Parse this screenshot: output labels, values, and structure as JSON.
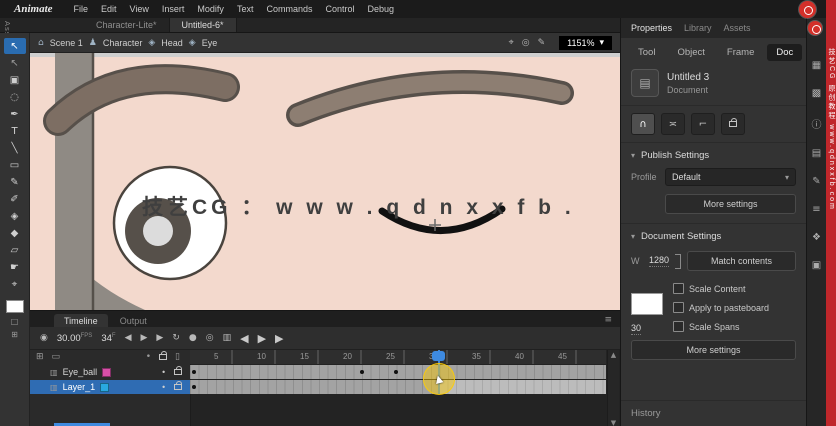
{
  "menu": {
    "logo": "Animate",
    "items": [
      "File",
      "Edit",
      "View",
      "Insert",
      "Modify",
      "Text",
      "Commands",
      "Control",
      "Debug"
    ]
  },
  "doc_tabs": [
    {
      "label": "Character-Lite*"
    },
    {
      "label": "Untitled-6*"
    }
  ],
  "left_rail": {
    "vertical_tab": "Assets"
  },
  "toolbar": {
    "tools": [
      {
        "name": "selection-tool",
        "glyph": "↖"
      },
      {
        "name": "subselection-tool",
        "glyph": "↖"
      },
      {
        "name": "free-transform-tool",
        "glyph": "▣"
      },
      {
        "name": "lasso-tool",
        "glyph": "◌"
      },
      {
        "name": "pen-tool",
        "glyph": "✒"
      },
      {
        "name": "text-tool",
        "glyph": "T"
      },
      {
        "name": "line-tool",
        "glyph": "╲"
      },
      {
        "name": "rectangle-tool",
        "glyph": "▭"
      },
      {
        "name": "pencil-tool",
        "glyph": "✎"
      },
      {
        "name": "brush-tool",
        "glyph": "✐"
      },
      {
        "name": "paint-bucket-tool",
        "glyph": "◈"
      },
      {
        "name": "eyedropper-tool",
        "glyph": "◆"
      },
      {
        "name": "eraser-tool",
        "glyph": "▱"
      },
      {
        "name": "hand-tool",
        "glyph": "☛"
      },
      {
        "name": "zoom-tool",
        "glyph": "⌖"
      }
    ],
    "extra1": "□",
    "extra2": "⊞"
  },
  "edit_bar": {
    "icons": {
      "home": "⌂",
      "character": "♟",
      "symbol": "◈",
      "center": "⌖",
      "camera": "◎",
      "edit": "✎",
      "caret": "▾"
    },
    "scene": "Scene 1",
    "crumb_character": "Character",
    "crumb_head": "Head",
    "crumb_eye": "Eye",
    "zoom": "1151%"
  },
  "canvas": {
    "watermark": "技艺CG ： w w w . q d n x x f b ."
  },
  "timeline": {
    "tabs": [
      "Timeline",
      "Output"
    ],
    "menu_icon": "≡",
    "fps": "30.00",
    "fps_unit": "FPS",
    "frame": "34",
    "frame_unit": "F",
    "controls": [
      {
        "name": "camera-icon",
        "glyph": "◉"
      },
      {
        "name": "step-back-button",
        "glyph": "◀"
      },
      {
        "name": "play-button",
        "glyph": "▶"
      },
      {
        "name": "step-forward-button",
        "glyph": "▶"
      },
      {
        "name": "loop-button",
        "glyph": "↻"
      },
      {
        "name": "onion-skin-button",
        "glyph": "●"
      },
      {
        "name": "onion-outline-button",
        "glyph": "◎"
      },
      {
        "name": "edit-multiple-frames-button",
        "glyph": "▥"
      },
      {
        "name": "prev-keyframe-button",
        "glyph": "◀"
      },
      {
        "name": "play-large-button",
        "glyph": "▶"
      },
      {
        "name": "next-keyframe-button",
        "glyph": "▶"
      }
    ],
    "header_icons": {
      "add": "⊞",
      "folder": "▭",
      "dot": "•",
      "outline": "▯"
    },
    "ruler": [
      "5",
      "10",
      "15",
      "20",
      "25",
      "30",
      "35",
      "40",
      "45"
    ],
    "layers": [
      {
        "name": "Eye_ball",
        "color": "#d84fa8"
      },
      {
        "name": "Layer_1",
        "color": "#29a8e0"
      }
    ],
    "scroll_up": "▲",
    "scroll_down": "▼"
  },
  "props": {
    "panel_tabs": [
      "Properties",
      "Library",
      "Assets"
    ],
    "mode_tabs": [
      "Tool",
      "Object",
      "Frame",
      "Doc"
    ],
    "doc_icon": "▤",
    "doc_name": "Untitled 3",
    "doc_kind": "Document",
    "snap_buttons": [
      {
        "name": "snap-magnet-button",
        "glyph": "∩"
      },
      {
        "name": "snap-align-button",
        "glyph": "≍"
      },
      {
        "name": "snap-grid-button",
        "glyph": "⌐"
      }
    ],
    "chevron": "▾",
    "publish_header": "Publish Settings",
    "profile_label": "Profile",
    "profile_value": "Default",
    "more_settings": "More settings",
    "doc_settings_header": "Document Settings",
    "width_label": "W",
    "width_value": "1280",
    "match_contents": "Match contents",
    "checks": [
      "Scale Content",
      "Apply to pasteboard",
      "Scale Spans"
    ],
    "fps_value": "30",
    "history_header": "History"
  },
  "dock": {
    "icons": [
      {
        "name": "align-panel-icon",
        "glyph": "▦"
      },
      {
        "name": "color-panel-icon",
        "glyph": "▩"
      },
      {
        "name": "info-panel-icon",
        "glyph": "ⓘ"
      },
      {
        "name": "swatches-panel-icon",
        "glyph": "▤"
      },
      {
        "name": "brush-panel-icon",
        "glyph": "✎"
      },
      {
        "name": "menu-panel-icon",
        "glyph": "≡"
      },
      {
        "name": "components-panel-icon",
        "glyph": "❖"
      },
      {
        "name": "library-panel-icon",
        "glyph": "▣"
      }
    ]
  },
  "ad": {
    "text": "技艺CG 原创教程 www.qdnxxfb.com"
  }
}
